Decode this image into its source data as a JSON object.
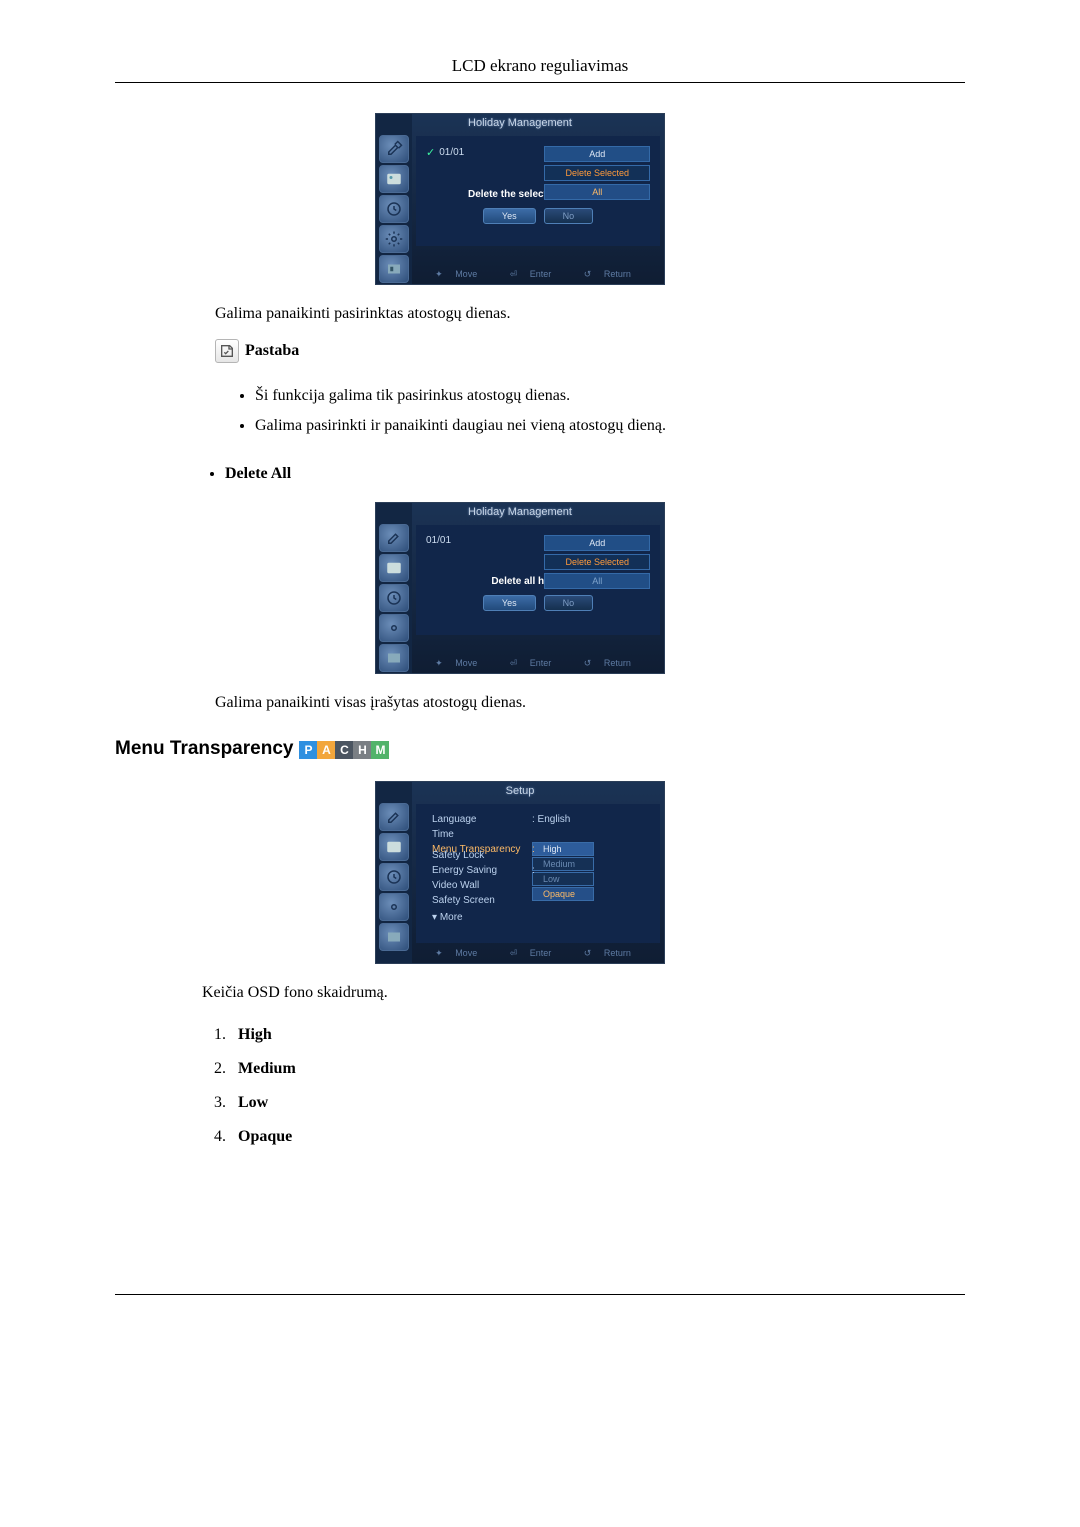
{
  "header": {
    "title": "LCD ekrano reguliavimas"
  },
  "osd": {
    "holiday_title": "Holiday Management",
    "holiday_date": "01/01",
    "side": {
      "add": "Add",
      "delete_selected": "Delete Selected",
      "all": "All"
    },
    "prompt_selected": "Delete the selected holidays?",
    "prompt_all": "Delete all holidays?",
    "yes": "Yes",
    "no": "No",
    "footer": {
      "move": "Move",
      "enter": "Enter",
      "return": "Return"
    },
    "setup_title": "Setup",
    "setup": {
      "language": "Language",
      "language_val": ": English",
      "time": "Time",
      "menu_transparency": "Menu Transparency",
      "safety_lock": "Safety Lock",
      "energy_saving": "Energy Saving",
      "video_wall": "Video Wall",
      "safety_screen": "Safety Screen",
      "more": "More",
      "colon": ":",
      "options": {
        "high": "High",
        "medium": "Medium",
        "low": "Low",
        "opaque": "Opaque"
      }
    }
  },
  "text": {
    "delete_selected_desc": "Galima panaikinti pasirinktas atostogų dienas.",
    "note_label": "Pastaba",
    "bullet1": "Ši funkcija galima tik pasirinkus atostogų dienas.",
    "bullet2": "Galima pasirinkti ir panaikinti daugiau nei vieną atostogų dieną.",
    "delete_all_label": "Delete All",
    "delete_all_desc": "Galima panaikinti visas įrašytas atostogų dienas.",
    "section_heading": "Menu Transparency",
    "section_desc": "Keičia OSD fono skaidrumą.",
    "list": {
      "high": "High",
      "medium": "Medium",
      "low": "Low",
      "opaque": "Opaque"
    }
  },
  "badges": {
    "p": "P",
    "a": "A",
    "c": "C",
    "h": "H",
    "m": "M"
  }
}
